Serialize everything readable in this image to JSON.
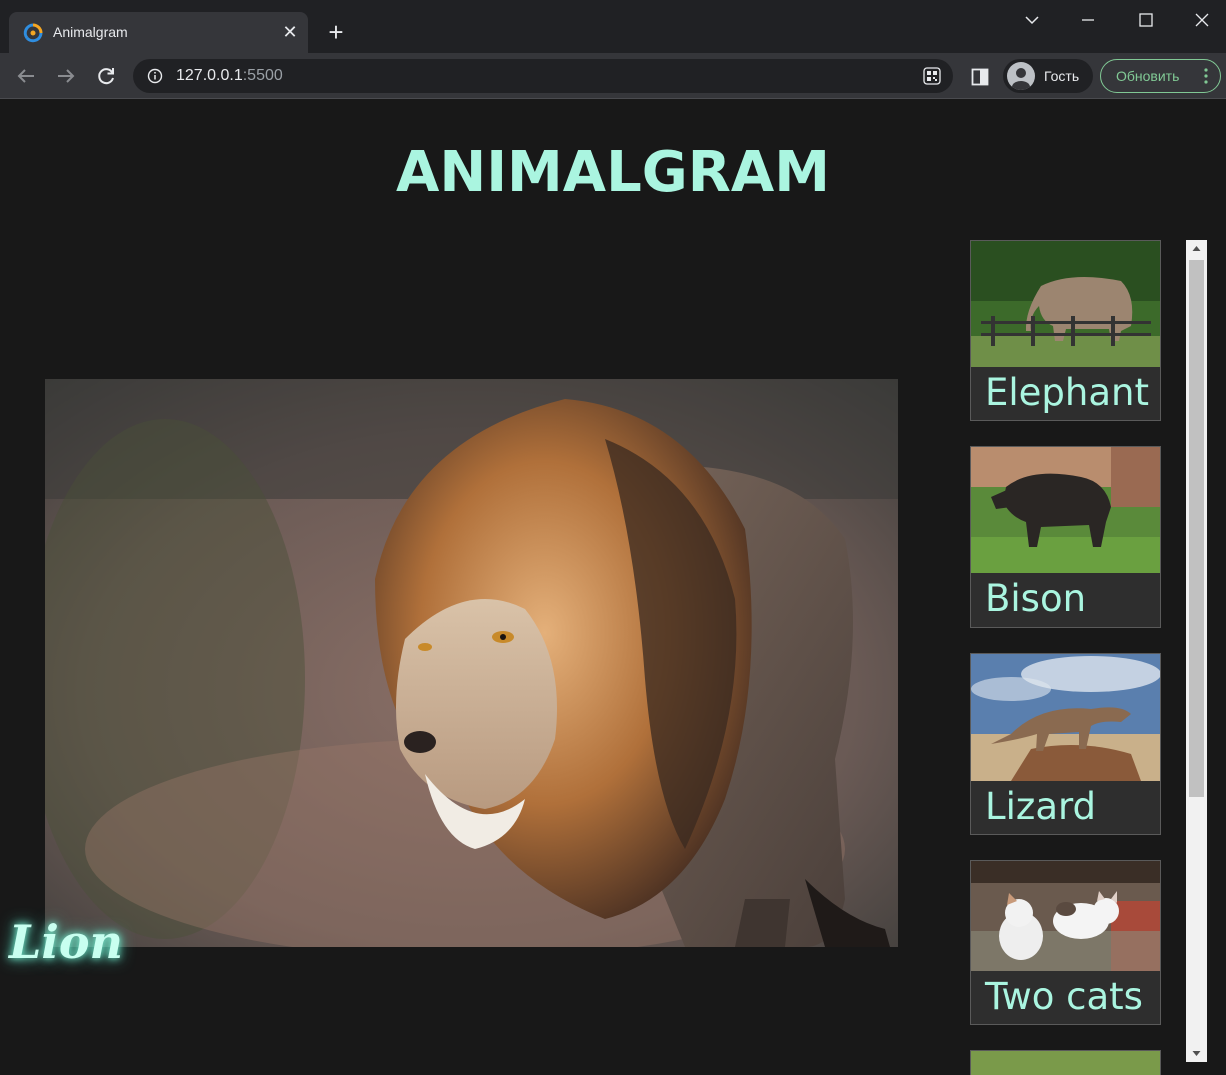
{
  "browser": {
    "tab_title": "Animalgram",
    "url_host": "127.0.0.1",
    "url_port": ":5500",
    "profile_label": "Гость",
    "update_label": "Обновить",
    "icons": [
      "favicon-icon",
      "close-icon",
      "plus-icon",
      "chevron-down-icon",
      "minimize-icon",
      "maximize-icon",
      "close-window-icon",
      "back-icon",
      "forward-icon",
      "reload-icon",
      "info-icon",
      "qr-code-icon",
      "side-panel-icon",
      "avatar-icon",
      "more-icon"
    ],
    "accent_color": "#81c995"
  },
  "page": {
    "title": "ANIMALGRAM",
    "main_caption": "Lion",
    "title_color": "#aaf5e0",
    "gallery": [
      {
        "label": "Elephant"
      },
      {
        "label": "Bison"
      },
      {
        "label": "Lizard"
      },
      {
        "label": "Two cats"
      }
    ]
  }
}
